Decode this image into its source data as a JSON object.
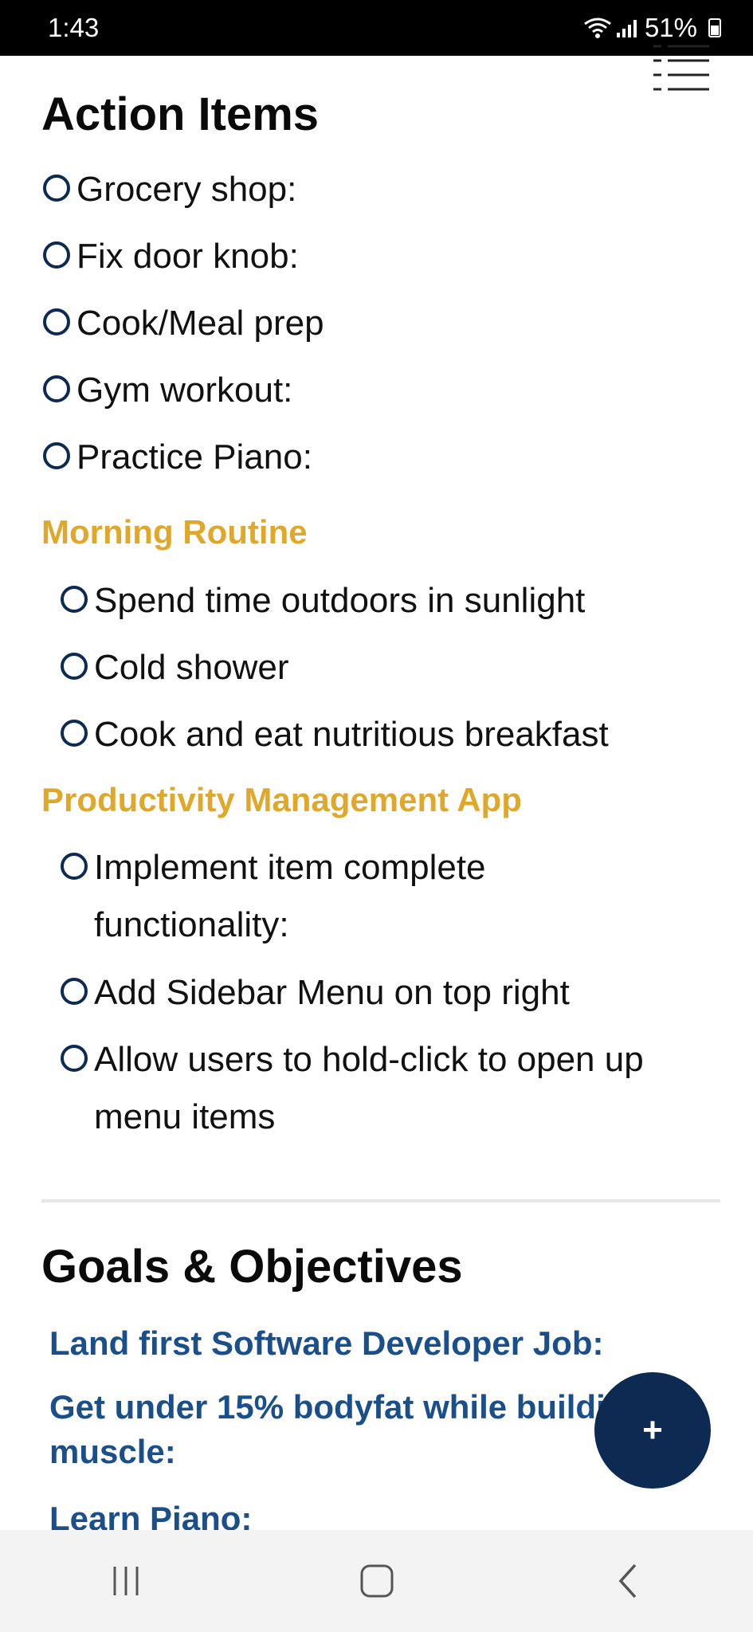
{
  "status": {
    "time": "1:43",
    "battery": "51%"
  },
  "action_items": {
    "title": "Action Items",
    "items": [
      {
        "label": "Grocery shop:"
      },
      {
        "label": "Fix door knob:"
      },
      {
        "label": "Cook/Meal prep"
      },
      {
        "label": "Gym workout:"
      },
      {
        "label": "Practice Piano:"
      }
    ],
    "groups": [
      {
        "title": "Morning Routine",
        "items": [
          {
            "label": "Spend time outdoors in sunlight"
          },
          {
            "label": "Cold shower"
          },
          {
            "label": "Cook and eat nutritious breakfast"
          }
        ]
      },
      {
        "title": "Productivity Management App",
        "items": [
          {
            "label": "Implement item complete functionality:"
          },
          {
            "label": "Add Sidebar Menu on top right"
          },
          {
            "label": "Allow users to hold-click to open up menu items"
          }
        ]
      }
    ]
  },
  "goals": {
    "title": "Goals & Objectives",
    "items": [
      {
        "label": "Land first Software Developer Job:"
      },
      {
        "label": "Get under 15% bodyfat while building muscle:"
      },
      {
        "label": "Learn Piano:"
      }
    ]
  },
  "fab": {
    "label": "+"
  },
  "colors": {
    "accent": "#0d2a52",
    "group_title": "#e0a82a",
    "goal_text": "#1a4f8a"
  },
  "icons": {
    "menu": "menu-lines-icon",
    "recents": "recents-icon",
    "home": "home-icon",
    "back": "back-icon"
  }
}
